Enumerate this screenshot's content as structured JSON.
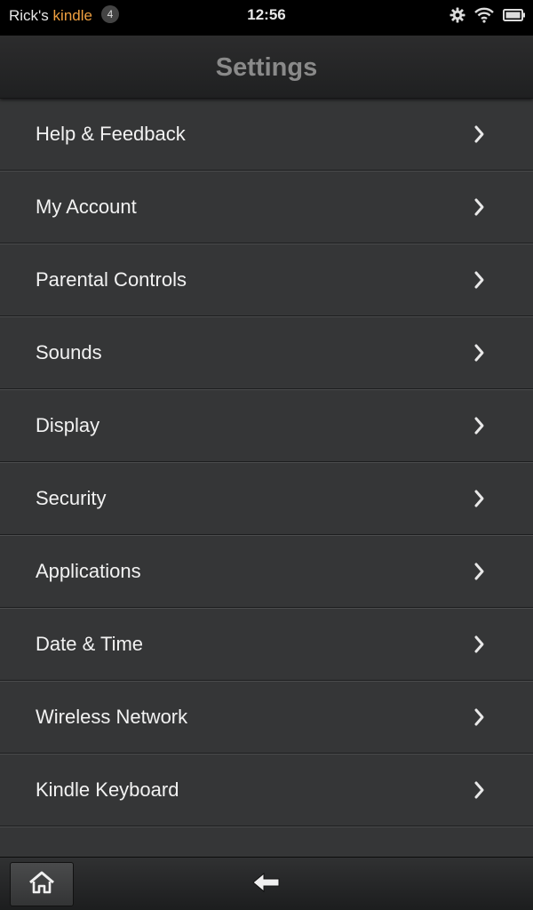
{
  "status_bar": {
    "device_owner": "Rick's",
    "device_brand": "kindle",
    "notification_count": "4",
    "time": "12:56",
    "icons": [
      "gear-icon",
      "wifi-icon",
      "battery-icon"
    ]
  },
  "header": {
    "title": "Settings"
  },
  "settings": {
    "items": [
      {
        "label": "Help & Feedback"
      },
      {
        "label": "My Account"
      },
      {
        "label": "Parental Controls"
      },
      {
        "label": "Sounds"
      },
      {
        "label": "Display"
      },
      {
        "label": "Security"
      },
      {
        "label": "Applications"
      },
      {
        "label": "Date & Time"
      },
      {
        "label": "Wireless Network"
      },
      {
        "label": "Kindle Keyboard"
      },
      {
        "label": ""
      }
    ]
  },
  "bottom_bar": {
    "icons": [
      "home-icon",
      "back-arrow-icon"
    ]
  },
  "colors": {
    "brand_accent": "#f0a040",
    "list_background": "#353637",
    "header_title": "#8a8a8a"
  }
}
